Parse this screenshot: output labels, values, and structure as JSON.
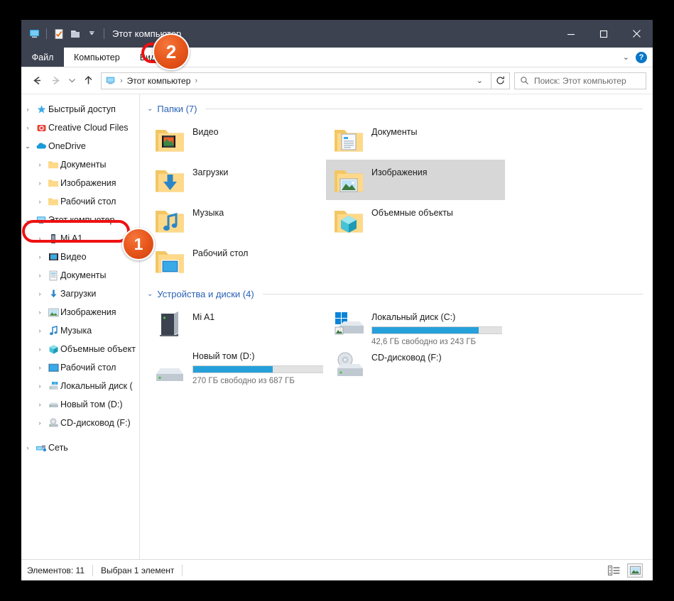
{
  "window": {
    "title": "Этот компьютер",
    "quick_access_icons": [
      "computer-icon",
      "properties-icon",
      "new-folder-icon",
      "customize-dropdown-icon"
    ],
    "controls": {
      "minimize": "—",
      "maximize": "☐",
      "close": "✕"
    }
  },
  "ribbon": {
    "tabs": [
      {
        "label": "Файл",
        "active_style": "file-menu"
      },
      {
        "label": "Компьютер",
        "active_style": "normal"
      },
      {
        "label": "Вид",
        "active_style": "normal"
      }
    ],
    "collapse_icon": "chevron-down-icon",
    "help_label": "?"
  },
  "navbar": {
    "back_icon": "arrow-left-icon",
    "forward_icon": "arrow-right-icon",
    "recent_icon": "chevron-down-icon",
    "up_icon": "arrow-up-icon",
    "address": {
      "root_icon": "computer-icon",
      "crumbs": [
        "Этот компьютер"
      ],
      "separator": "›",
      "dropdown_icon": "chevron-down-icon"
    },
    "refresh_icon": "refresh-icon",
    "search": {
      "icon": "search-icon",
      "placeholder": "Поиск: Этот компьютер",
      "value": ""
    }
  },
  "sidebar": {
    "items": [
      {
        "label": "Быстрый доступ",
        "icon": "pin-star-icon",
        "level": 1,
        "expanded": false,
        "chevron": "›"
      },
      {
        "label": "Creative Cloud Files",
        "icon": "creative-cloud-icon",
        "level": 1,
        "expanded": false,
        "chevron": "›"
      },
      {
        "label": "OneDrive",
        "icon": "onedrive-cloud-icon",
        "level": 1,
        "expanded": true,
        "chevron": "⌄"
      },
      {
        "label": "Документы",
        "icon": "folder-icon",
        "level": 2,
        "expanded": false,
        "chevron": "›"
      },
      {
        "label": "Изображения",
        "icon": "folder-icon",
        "level": 2,
        "expanded": false,
        "chevron": "›"
      },
      {
        "label": "Рабочий стол",
        "icon": "folder-icon",
        "level": 2,
        "expanded": false,
        "chevron": "›"
      },
      {
        "label": "Этот компьютер",
        "icon": "computer-icon",
        "level": 1,
        "expanded": true,
        "chevron": "⌄",
        "highlighted": true
      },
      {
        "label": "Mi A1",
        "icon": "phone-icon",
        "level": 2,
        "expanded": false,
        "chevron": "›"
      },
      {
        "label": "Видео",
        "icon": "video-folder-icon",
        "level": 2,
        "expanded": false,
        "chevron": "›"
      },
      {
        "label": "Документы",
        "icon": "documents-folder-icon",
        "level": 2,
        "expanded": false,
        "chevron": "›"
      },
      {
        "label": "Загрузки",
        "icon": "downloads-folder-icon",
        "level": 2,
        "expanded": false,
        "chevron": "›"
      },
      {
        "label": "Изображения",
        "icon": "pictures-folder-icon",
        "level": 2,
        "expanded": false,
        "chevron": "›"
      },
      {
        "label": "Музыка",
        "icon": "music-folder-icon",
        "level": 2,
        "expanded": false,
        "chevron": "›"
      },
      {
        "label": "Объемные объект",
        "icon": "3d-objects-icon",
        "level": 2,
        "expanded": false,
        "chevron": "›"
      },
      {
        "label": "Рабочий стол",
        "icon": "desktop-icon",
        "level": 2,
        "expanded": false,
        "chevron": "›"
      },
      {
        "label": "Локальный диск (",
        "icon": "local-disk-icon",
        "level": 2,
        "expanded": false,
        "chevron": "›"
      },
      {
        "label": "Новый том (D:)",
        "icon": "drive-icon",
        "level": 2,
        "expanded": false,
        "chevron": "›"
      },
      {
        "label": "CD-дисковод (F:)",
        "icon": "cd-drive-icon",
        "level": 2,
        "expanded": false,
        "chevron": "›"
      },
      {
        "label": "Сеть",
        "icon": "network-icon",
        "level": 1,
        "expanded": false,
        "chevron": "›",
        "gap_before": true
      }
    ]
  },
  "content": {
    "groups": [
      {
        "header": "Папки (7)",
        "chevron": "⌄",
        "items": [
          {
            "name": "Видео",
            "icon": "video-folder-icon",
            "selected": false
          },
          {
            "name": "Документы",
            "icon": "documents-folder-icon",
            "selected": false
          },
          {
            "name": "Загрузки",
            "icon": "downloads-folder-icon",
            "selected": false
          },
          {
            "name": "Изображения",
            "icon": "pictures-folder-icon",
            "selected": true
          },
          {
            "name": "Музыка",
            "icon": "music-folder-icon",
            "selected": false
          },
          {
            "name": "Объемные объекты",
            "icon": "3d-objects-icon",
            "selected": false
          },
          {
            "name": "Рабочий стол",
            "icon": "desktop-folder-icon",
            "selected": false
          }
        ]
      },
      {
        "header": "Устройства и диски (4)",
        "chevron": "⌄",
        "items": [
          {
            "name": "Mi A1",
            "icon": "phone-device-icon",
            "selected": false,
            "has_bar": false,
            "sub": ""
          },
          {
            "name": "Локальный диск (C:)",
            "icon": "windows-disk-icon",
            "selected": false,
            "has_bar": true,
            "fill_percent": 82,
            "sub": "42,6 ГБ свободно из 243 ГБ"
          },
          {
            "name": "Новый том (D:)",
            "icon": "drive-icon",
            "selected": false,
            "has_bar": true,
            "fill_percent": 61,
            "sub": "270 ГБ свободно из 687 ГБ"
          },
          {
            "name": "CD-дисковод (F:)",
            "icon": "cd-drive-icon",
            "selected": false,
            "has_bar": false,
            "sub": ""
          }
        ]
      }
    ]
  },
  "statusbar": {
    "item_count": "Элементов: 11",
    "selection": "Выбран 1 элемент",
    "details_view_icon": "details-view-icon",
    "thumbnails_view_icon": "large-icons-view-icon"
  },
  "annotations": [
    {
      "badge": "1",
      "target": "sidebar-item-this-pc"
    },
    {
      "badge": "2",
      "target": "ribbon-tab-view"
    }
  ],
  "colors": {
    "titlebar": "#3c4250",
    "accent_blue": "#26a0da",
    "group_header": "#2a62b4",
    "annotation_red": "#ee1111",
    "annotation_orange": "#e8571c",
    "selection_gray": "#d7d7d7"
  }
}
